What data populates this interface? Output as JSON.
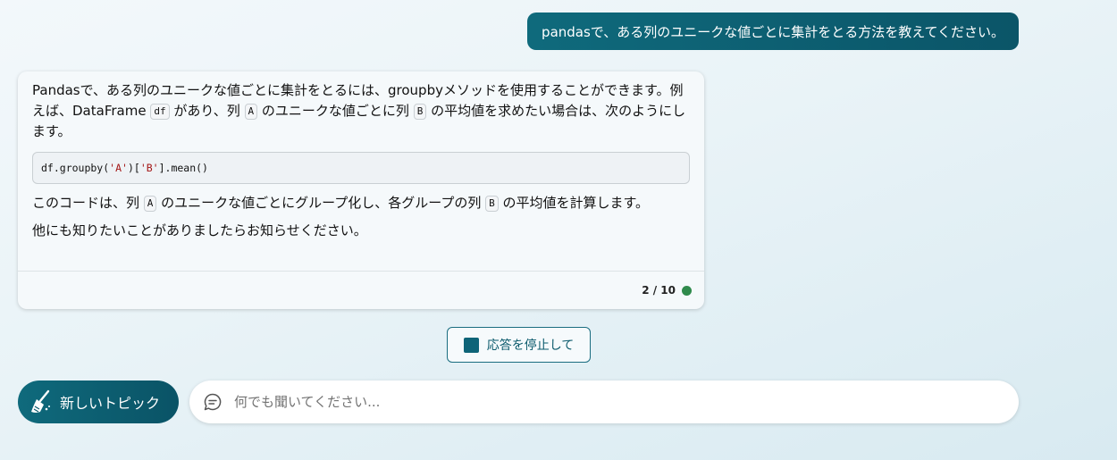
{
  "user_message": "pandasで、ある列のユニークな値ごとに集計をとる方法を教えてください。",
  "bot": {
    "p1_a": "Pandasで、ある列のユニークな値ごとに集計をとるには、groupbyメソッドを使用することができます。例えば、DataFrame ",
    "p1_code1": "df",
    "p1_b": " があり、列 ",
    "p1_code2": "A",
    "p1_c": " のユニークな値ごとに列 ",
    "p1_code3": "B",
    "p1_d": " の平均値を求めたい場合は、次のようにします。",
    "code": {
      "part1": "df.groupby(",
      "str1": "'A'",
      "part2": ")[",
      "str2": "'B'",
      "part3": "].mean()"
    },
    "p2_a": "このコードは、列 ",
    "p2_code1": "A",
    "p2_b": " のユニークな値ごとにグループ化し、各グループの列 ",
    "p2_code2": "B",
    "p2_c": " の平均値を計算します。",
    "p3": "他にも知りたいことがありましたらお知らせください。",
    "turn_counter": "2 / 10",
    "status_color": "#2f8a4c"
  },
  "stop_button": {
    "label": "応答を停止して",
    "icon": "stop-square-icon"
  },
  "new_topic_button": {
    "label": "新しいトピック",
    "icon": "broom-icon"
  },
  "input": {
    "placeholder": "何でも聞いてください...",
    "value": "",
    "icon": "chat-bubble-icon"
  },
  "colors": {
    "accent": "#0b5568",
    "code_string": "#a31515"
  }
}
